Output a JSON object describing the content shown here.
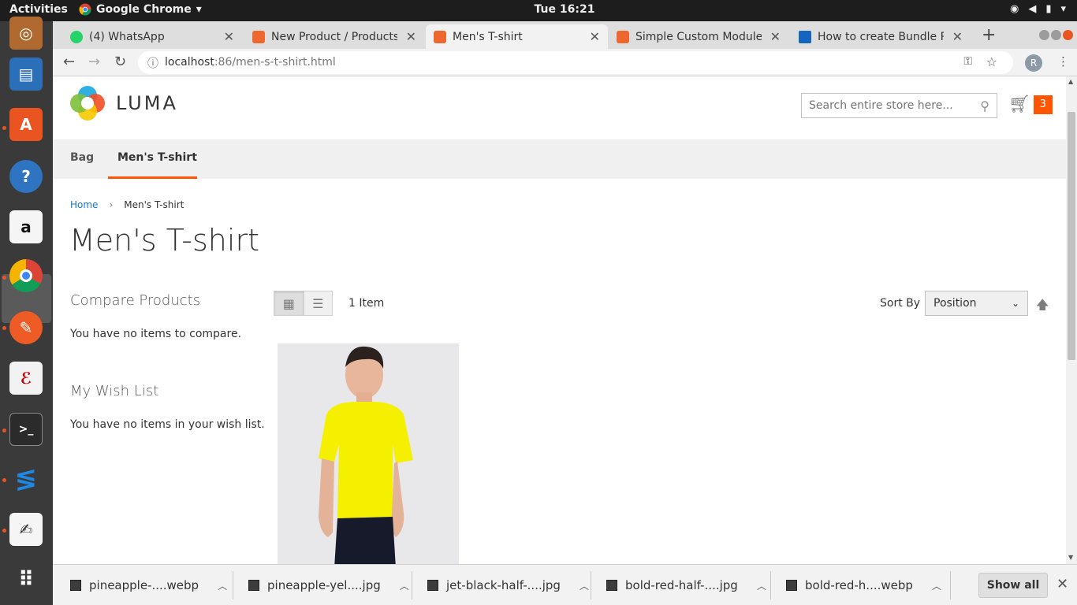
{
  "topbar": {
    "activities": "Activities",
    "app_name": "Google Chrome",
    "clock": "Tue 16:21"
  },
  "dock": {
    "items": [
      "ubuntu-software",
      "libreoffice-writer",
      "app-store",
      "help",
      "amazon",
      "chrome",
      "postman",
      "evince",
      "terminal",
      "vscode",
      "text-editor",
      "show-applications"
    ]
  },
  "browser": {
    "tabs": [
      {
        "title": "(4) WhatsApp",
        "favicon": "whatsapp-icon",
        "color": "#25d366"
      },
      {
        "title": "New Product / Products",
        "favicon": "magento-icon",
        "color": "#ee672f"
      },
      {
        "title": "Men's T-shirt",
        "favicon": "magento-icon",
        "color": "#ee672f"
      },
      {
        "title": "Simple Custom Module",
        "favicon": "magento-icon",
        "color": "#ee672f"
      },
      {
        "title": "How to create Bundle Pr",
        "favicon": "site-icon",
        "color": "#1565c0"
      }
    ],
    "url_host": "localhost",
    "url_rest": ":86/men-s-t-shirt.html",
    "profile_initial": "R"
  },
  "store": {
    "logo_text": "LUMA",
    "search_placeholder": "Search entire store here...",
    "cart_count": "3",
    "accent_color": "#ff5501",
    "nav": [
      "Bag",
      "Men's T-shirt"
    ],
    "breadcrumb_home": "Home",
    "breadcrumb_sep": "›",
    "breadcrumb_current": "Men's T-shirt",
    "page_title": "Men's T-shirt",
    "compare_title": "Compare Products",
    "compare_empty": "You have no items to compare.",
    "wishlist_title": "My Wish List",
    "wishlist_empty": "You have no items in your wish list.",
    "item_count": "1 Item",
    "sort_label": "Sort By",
    "sort_value": "Position"
  },
  "downloads": {
    "files": [
      "pineapple-....webp",
      "pineapple-yel....jpg",
      "jet-black-half-....jpg",
      "bold-red-half-....jpg",
      "bold-red-h....webp"
    ],
    "show_all": "Show all"
  }
}
